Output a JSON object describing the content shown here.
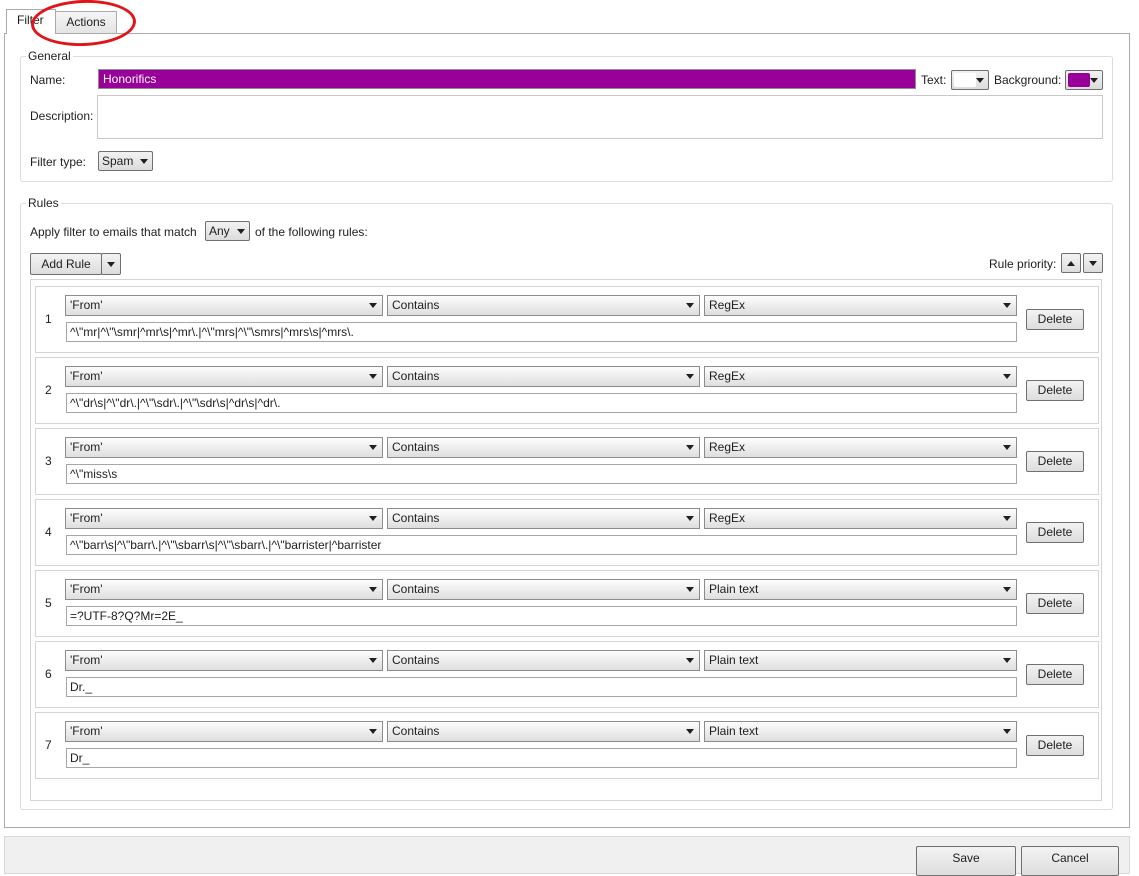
{
  "tabs": [
    {
      "label": "Filter",
      "active": true
    },
    {
      "label": "Actions",
      "active": false
    }
  ],
  "general": {
    "legend": "General",
    "name_label": "Name:",
    "name_value": "Honorifics",
    "name_background": "#990099",
    "text_label": "Text:",
    "text_color": "#ffffff",
    "background_label": "Background:",
    "background_color": "#990099",
    "description_label": "Description:",
    "description_value": "",
    "filter_type_label": "Filter type:",
    "filter_type_value": "Spam"
  },
  "rules": {
    "legend": "Rules",
    "apply_prefix": "Apply filter to emails that match",
    "match_value": "Any",
    "apply_suffix": "of the following rules:",
    "add_rule_label": "Add Rule",
    "priority_label": "Rule priority:",
    "delete_label": "Delete",
    "items": [
      {
        "num": "1",
        "field": "'From'",
        "operator": "Contains",
        "mode": "RegEx",
        "value": "^\\\"mr|^\\\"\\smr|^mr\\s|^mr\\.|^\\\"mrs|^\\\"\\smrs|^mrs\\s|^mrs\\."
      },
      {
        "num": "2",
        "field": "'From'",
        "operator": "Contains",
        "mode": "RegEx",
        "value": "^\\\"dr\\s|^\\\"dr\\.|^\\\"\\sdr\\.|^\\\"\\sdr\\s|^dr\\s|^dr\\."
      },
      {
        "num": "3",
        "field": "'From'",
        "operator": "Contains",
        "mode": "RegEx",
        "value": "^\\\"miss\\s"
      },
      {
        "num": "4",
        "field": "'From'",
        "operator": "Contains",
        "mode": "RegEx",
        "value": "^\\\"barr\\s|^\\\"barr\\.|^\\\"\\sbarr\\s|^\\\"\\sbarr\\.|^\\\"barrister|^barrister"
      },
      {
        "num": "5",
        "field": "'From'",
        "operator": "Contains",
        "mode": "Plain text",
        "value": "=?UTF-8?Q?Mr=2E_"
      },
      {
        "num": "6",
        "field": "'From'",
        "operator": "Contains",
        "mode": "Plain text",
        "value": "Dr._"
      },
      {
        "num": "7",
        "field": "'From'",
        "operator": "Contains",
        "mode": "Plain text",
        "value": "Dr_"
      }
    ]
  },
  "footer": {
    "save_label": "Save",
    "cancel_label": "Cancel"
  },
  "annotation": {
    "color": "#e0141a"
  }
}
